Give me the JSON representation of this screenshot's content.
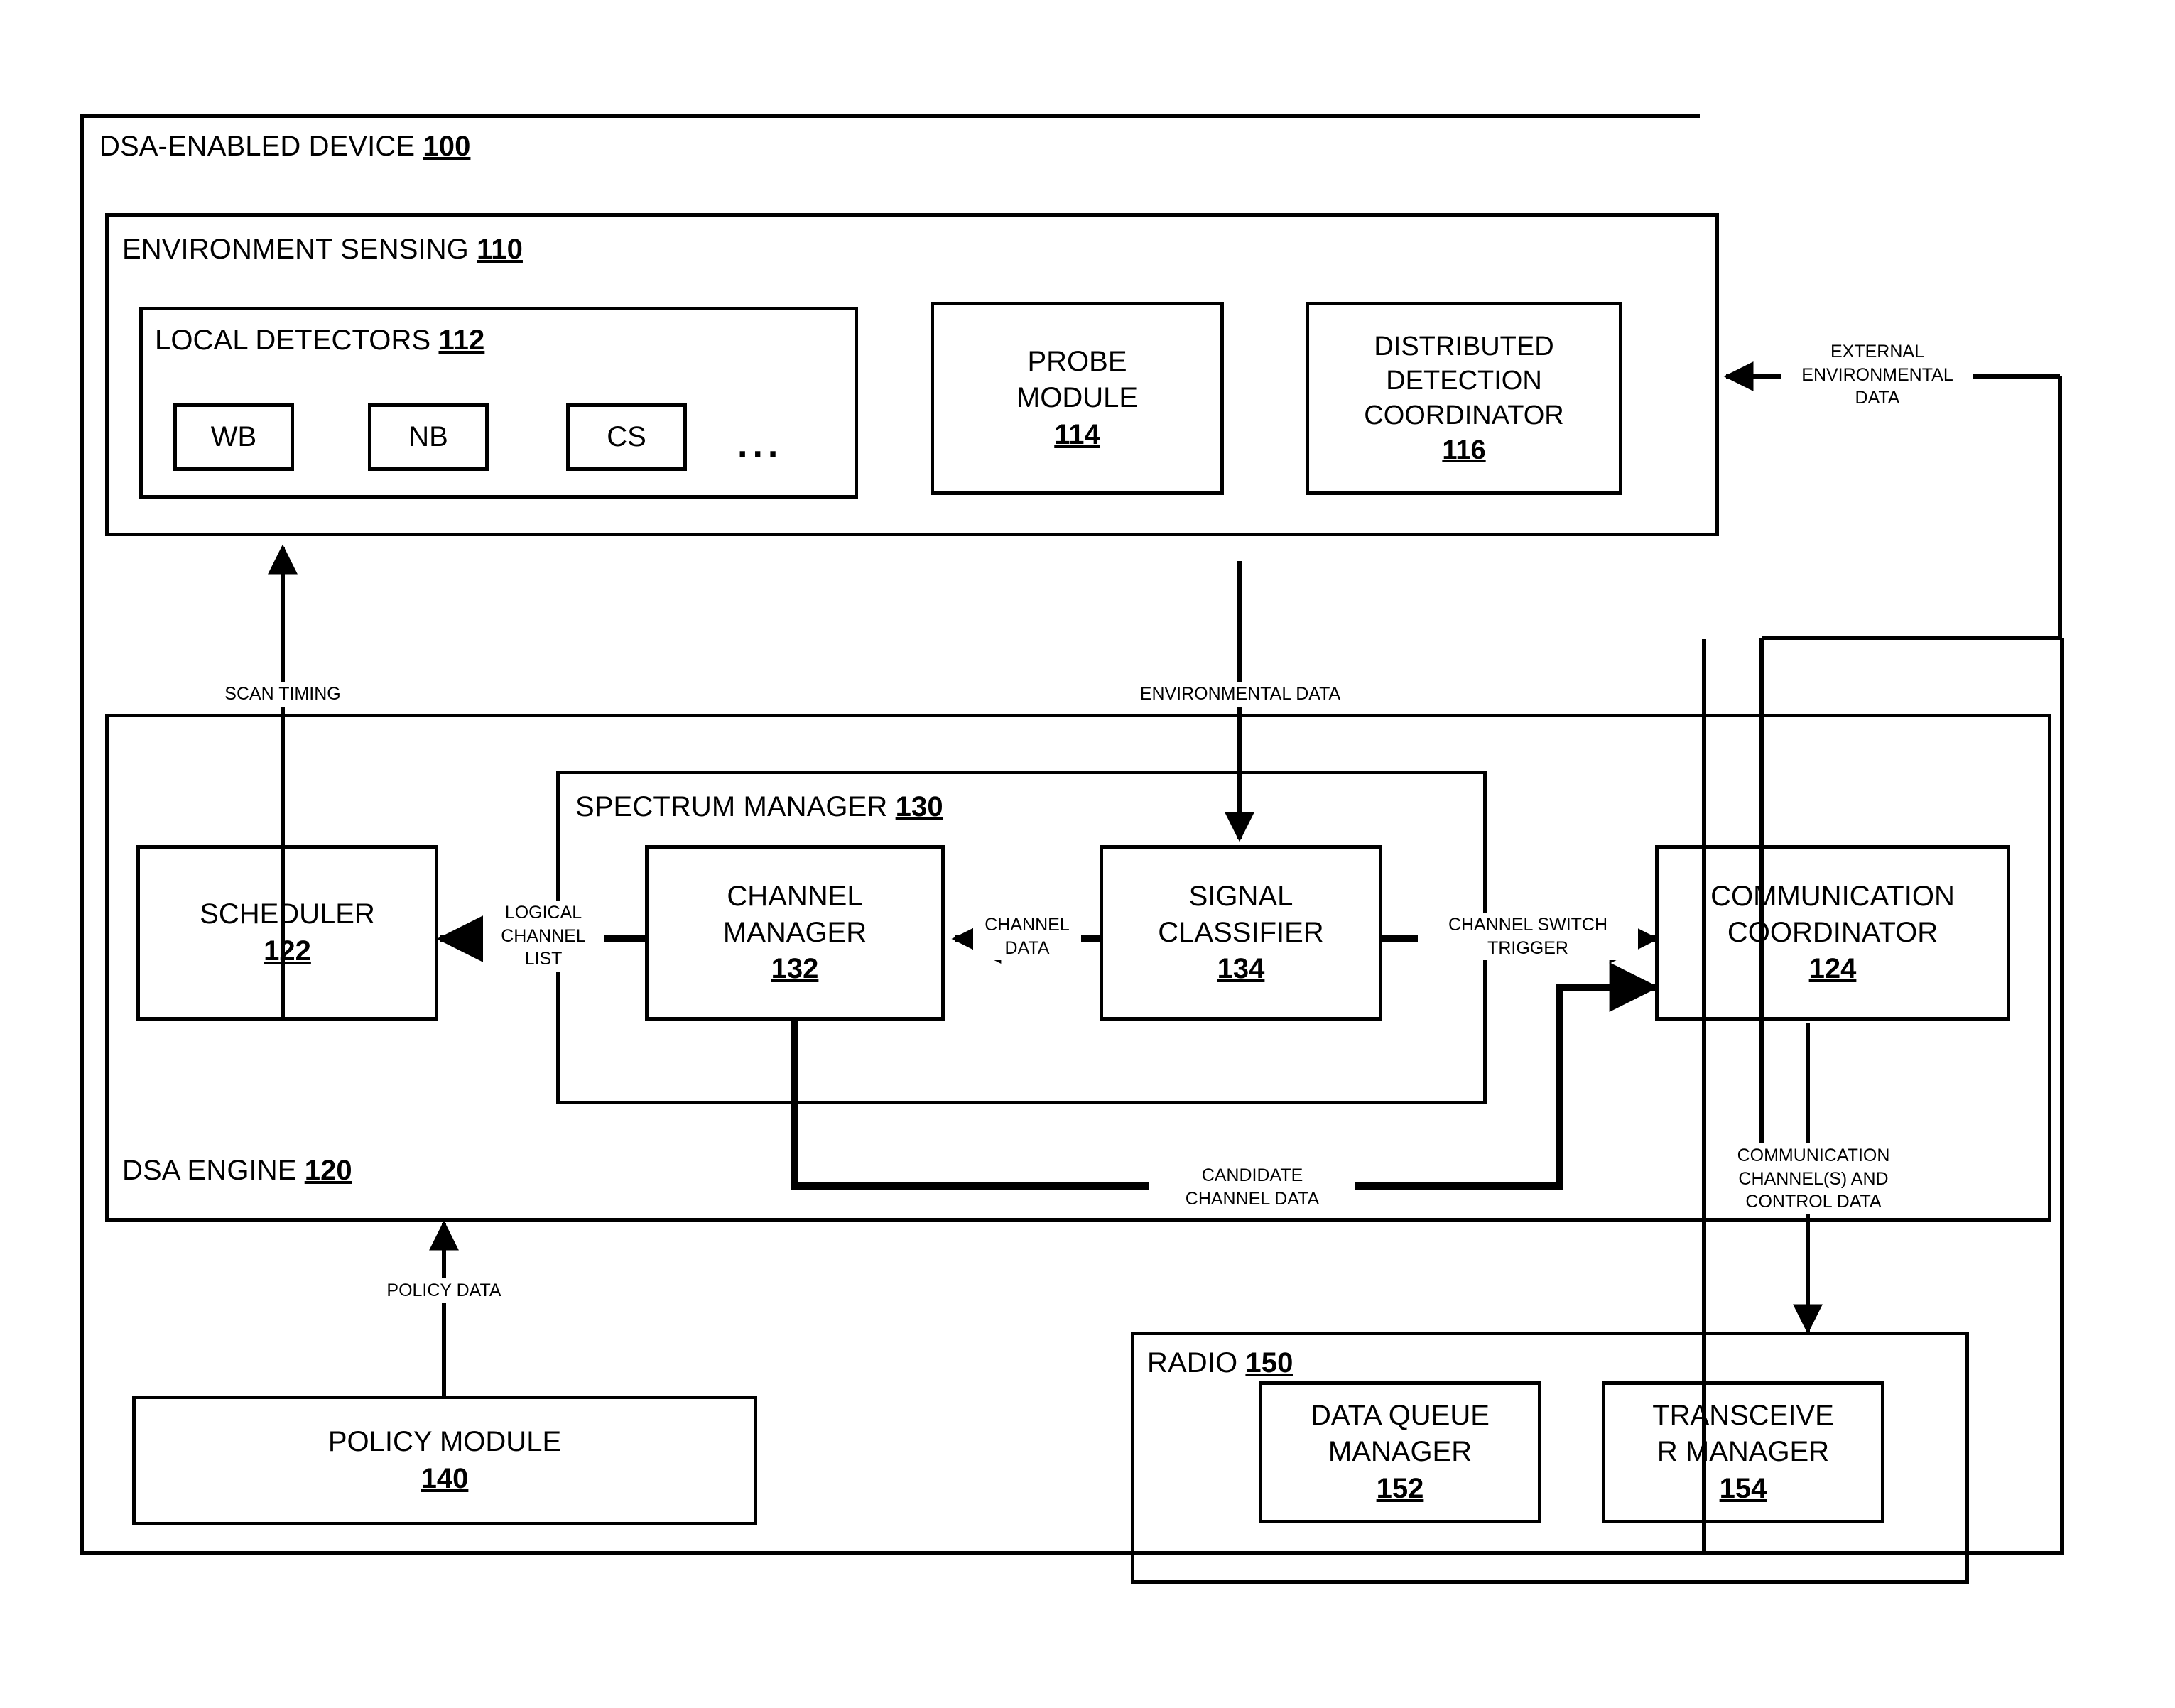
{
  "diagram": {
    "title": "DSA-Enabled Device Block Diagram"
  },
  "containers": {
    "device": {
      "name": "DSA-ENABLED DEVICE",
      "number": "100"
    },
    "environment_sensing": {
      "name": "ENVIRONMENT SENSING",
      "number": "110"
    },
    "local_detectors": {
      "name": "LOCAL DETECTORS",
      "number": "112"
    },
    "dsa_engine": {
      "name": "DSA ENGINE",
      "number": "120"
    },
    "spectrum_manager": {
      "name": "SPECTRUM MANAGER",
      "number": "130"
    },
    "radio": {
      "name": "RADIO",
      "number": "150"
    }
  },
  "detectors": [
    {
      "label": "WB"
    },
    {
      "label": "NB"
    },
    {
      "label": "CS"
    }
  ],
  "detectors_ellipsis": "...",
  "blocks": {
    "probe_module": {
      "lines": [
        "PROBE",
        "MODULE"
      ],
      "number": "114"
    },
    "distributed_detection_coordinator": {
      "lines": [
        "DISTRIBUTED",
        "DETECTION",
        "COORDINATOR"
      ],
      "number": "116"
    },
    "scheduler": {
      "lines": [
        "SCHEDULER"
      ],
      "number": "122"
    },
    "channel_manager": {
      "lines": [
        "CHANNEL",
        "MANAGER"
      ],
      "number": "132"
    },
    "signal_classifier": {
      "lines": [
        "SIGNAL",
        "CLASSIFIER"
      ],
      "number": "134"
    },
    "communication_coordinator": {
      "lines": [
        "COMMUNICATION",
        "COORDINATOR"
      ],
      "number": "124"
    },
    "policy_module": {
      "lines": [
        "POLICY MODULE"
      ],
      "number": "140"
    },
    "data_queue_manager": {
      "lines": [
        "DATA QUEUE",
        "MANAGER"
      ],
      "number": "152"
    },
    "transceiver_manager": {
      "lines": [
        "TRANSCEIVE",
        "R MANAGER"
      ],
      "number": "154"
    }
  },
  "edge_labels": {
    "external_environmental_data": "EXTERNAL\nENVIRONMENTAL\nDATA",
    "scan_timing": "SCAN TIMING",
    "environmental_data": "ENVIRONMENTAL DATA",
    "logical_channel_list": "LOGICAL\nCHANNEL\nLIST",
    "channel_data": "CHANNEL\nDATA",
    "channel_switch_trigger": "CHANNEL SWITCH\nTRIGGER",
    "candidate_channel_data": "CANDIDATE\nCHANNEL DATA",
    "communication_channels_and_control_data": "COMMUNICATION\nCHANNEL(S) AND\nCONTROL DATA",
    "policy_data": "POLICY DATA"
  },
  "style": {
    "stroke": "#000000",
    "background": "#ffffff"
  }
}
